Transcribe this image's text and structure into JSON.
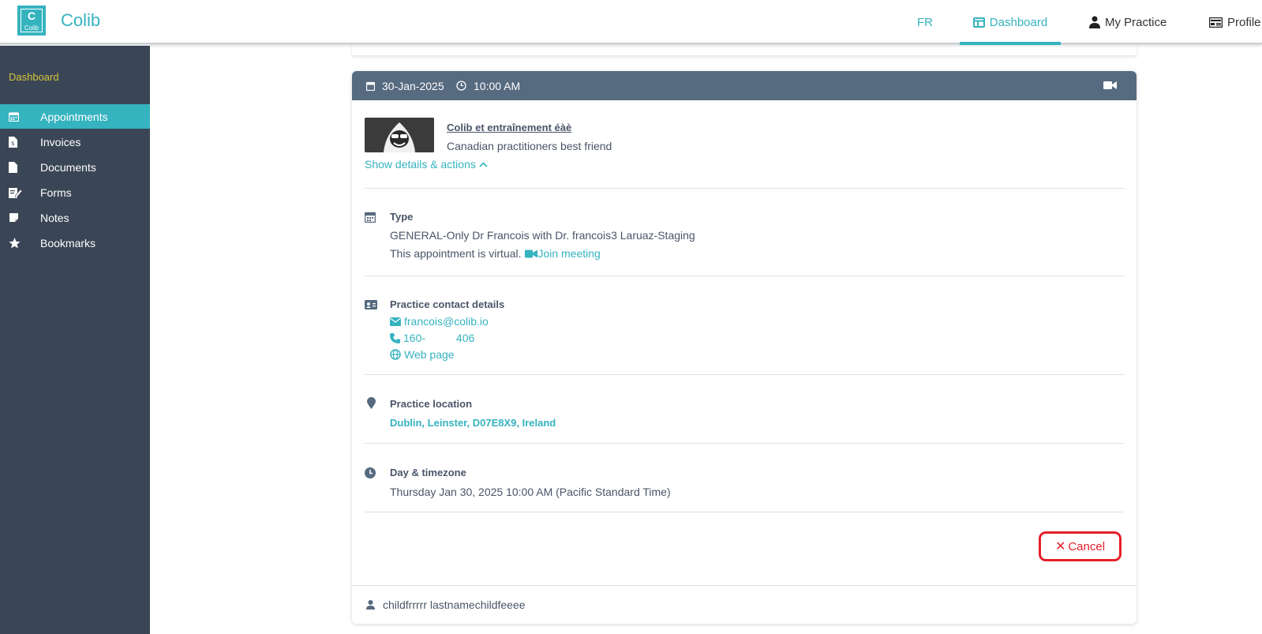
{
  "header": {
    "logo_letter": "C",
    "logo_text": "Colib",
    "brand": "Colib",
    "nav": {
      "lang": "FR",
      "dashboard": "Dashboard",
      "my_practice": "My Practice",
      "profile": "Profile"
    },
    "accent_color": "#35b3bf"
  },
  "sidebar": {
    "title": "Dashboard",
    "items": [
      {
        "label": "Appointments",
        "icon": "calendar-icon",
        "active": true
      },
      {
        "label": "Invoices",
        "icon": "invoice-icon"
      },
      {
        "label": "Documents",
        "icon": "document-icon"
      },
      {
        "label": "Forms",
        "icon": "form-edit-icon"
      },
      {
        "label": "Notes",
        "icon": "note-icon"
      },
      {
        "label": "Bookmarks",
        "icon": "star-icon"
      }
    ]
  },
  "appointment": {
    "date": "30-Jan-2025",
    "time": "10:00 AM",
    "practice_name": "Colib et entraînement éàè",
    "practice_tagline": "Canadian practitioners best friend",
    "show_details": "Show details & actions",
    "type_title": "Type",
    "type_value": "GENERAL-Only Dr Francois with Dr. francois3 Laruaz-Staging",
    "virtual_text": "This appointment is virtual.",
    "join_meeting": "Join meeting",
    "contact_title": "Practice contact details",
    "email": "francois@colib.io",
    "phone": "160-          406",
    "web_page": "Web page",
    "location_title": "Practice location",
    "location": "Dublin, Leinster, D07E8X9, Ireland",
    "timezone_title": "Day & timezone",
    "timezone_value": "Thursday Jan 30, 2025 10:00 AM (Pacific Standard Time)",
    "cancel_label": "Cancel",
    "patient": "childfrrrrr lastnamechildfeeee"
  }
}
